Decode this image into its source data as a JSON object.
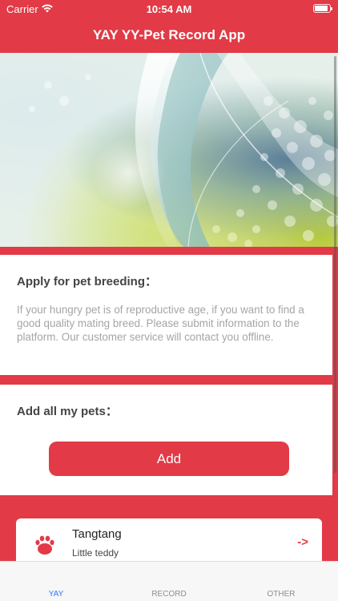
{
  "status_bar": {
    "carrier": "Carrier",
    "time": "10:54 AM",
    "battery_level": 0.9
  },
  "nav": {
    "title": "YAY YY-Pet Record App"
  },
  "breeding_card": {
    "title": "Apply for pet breeding：",
    "description": "If your hungry pet is of reproductive age, if you want to find a good quality mating breed. Please submit information to the platform. Our customer service will contact you offline."
  },
  "add_card": {
    "title": "Add all my pets：",
    "button_label": "Add"
  },
  "pets": [
    {
      "name": "Tangtang",
      "breed": "Little teddy",
      "arrow": "->",
      "icon": "paw-icon"
    }
  ],
  "tabs": [
    {
      "label": "YAY",
      "active": true
    },
    {
      "label": "RECORD",
      "active": false
    },
    {
      "label": "OTHER",
      "active": false
    }
  ],
  "colors": {
    "brand_red": "#e23a46",
    "tab_active": "#3478f6",
    "tab_inactive": "#8e8e8e"
  }
}
